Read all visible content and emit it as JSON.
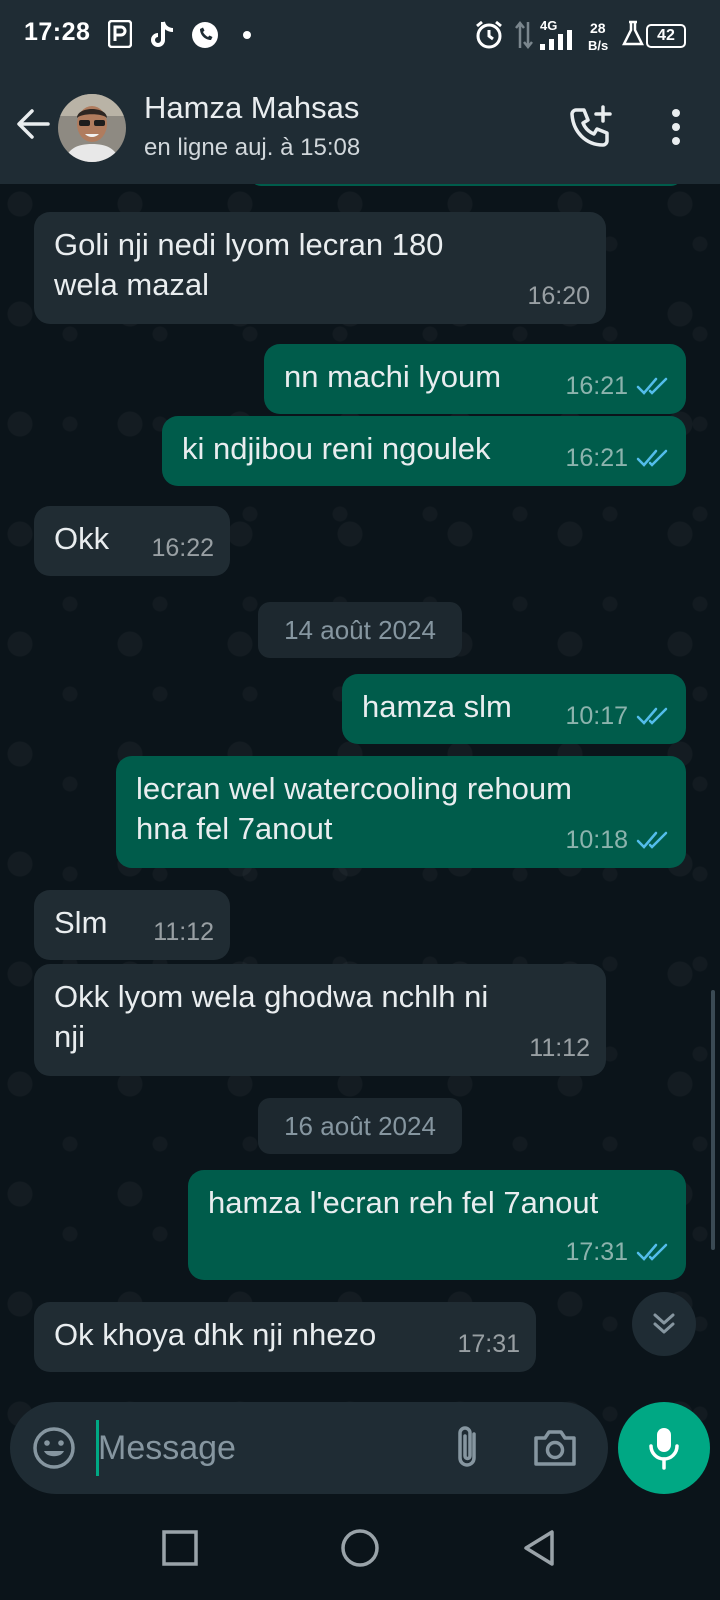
{
  "status_bar": {
    "time": "17:28",
    "network": "4G",
    "speed_value": "28",
    "speed_unit": "B/s",
    "battery": "42",
    "icons": [
      "parking-icon",
      "tiktok-icon",
      "whatsapp-icon",
      "dot-icon",
      "alarm-icon",
      "data-arrows-icon",
      "signal-icon",
      "flask-icon",
      "battery-icon"
    ]
  },
  "header": {
    "contact_name": "Hamza Mahsas",
    "contact_status": "en ligne auj. à 15:08"
  },
  "messages": [
    {
      "direction": "in",
      "text_lines": [
        "Goli nji nedi lyom lecran 180",
        "wela mazal"
      ],
      "time": "16:20"
    },
    {
      "direction": "out",
      "text_lines": [
        "nn machi lyoum"
      ],
      "time": "16:21",
      "status": "read"
    },
    {
      "direction": "out",
      "text_lines": [
        "ki ndjibou reni ngoulek"
      ],
      "time": "16:21",
      "status": "read"
    },
    {
      "direction": "in",
      "text_lines": [
        "Okk"
      ],
      "time": "16:22"
    },
    {
      "type": "date",
      "label": "14 août 2024"
    },
    {
      "direction": "out",
      "text_lines": [
        "hamza slm"
      ],
      "time": "10:17",
      "status": "read"
    },
    {
      "direction": "out",
      "text_lines": [
        "lecran wel watercooling rehoum",
        "hna fel 7anout"
      ],
      "time": "10:18",
      "status": "read"
    },
    {
      "direction": "in",
      "text_lines": [
        "Slm"
      ],
      "time": "11:12"
    },
    {
      "direction": "in",
      "text_lines": [
        "Okk lyom wela ghodwa nchlh ni",
        "nji"
      ],
      "time": "11:12"
    },
    {
      "type": "date",
      "label": "16 août 2024"
    },
    {
      "direction": "out",
      "text_lines": [
        "hamza l'ecran reh fel 7anout"
      ],
      "time": "17:31",
      "status": "read"
    },
    {
      "direction": "in",
      "text_lines": [
        "Ok khoya dhk nji nhezo"
      ],
      "time": "17:31"
    }
  ],
  "input": {
    "placeholder": "Message"
  },
  "colors": {
    "header_bg": "#1f2c34",
    "chat_bg": "#0b141a",
    "incoming_bubble": "#202c33",
    "outgoing_bubble": "#005c4b",
    "accent": "#00a884",
    "read_ticks": "#53bdeb"
  }
}
